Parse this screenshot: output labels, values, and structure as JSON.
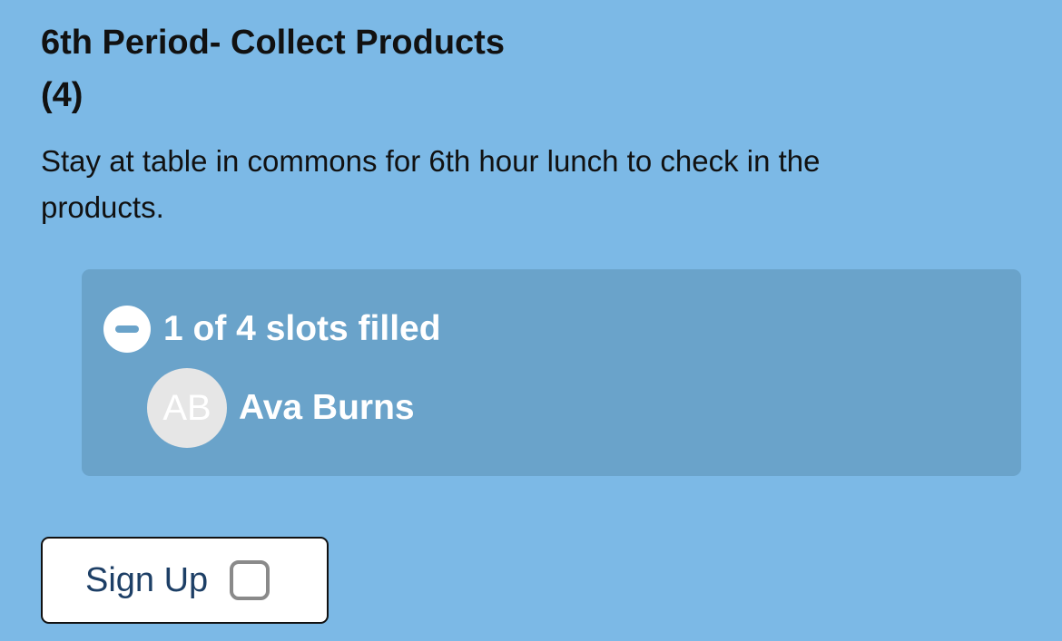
{
  "slot": {
    "title": "6th Period- Collect Products",
    "count": "(4)",
    "description": "Stay at table in commons for 6th hour lunch to check in the products."
  },
  "slots_panel": {
    "toggle_icon": "minus-circle-icon",
    "status": "1 of 4 slots filled",
    "volunteers": [
      {
        "initials": "AB",
        "name": "Ava Burns"
      }
    ]
  },
  "signup": {
    "label": "Sign Up",
    "checkbox_checked": false
  },
  "colors": {
    "background": "#7cb9e6",
    "panel": "#6aa3ca",
    "button_text": "#1d3f66"
  }
}
